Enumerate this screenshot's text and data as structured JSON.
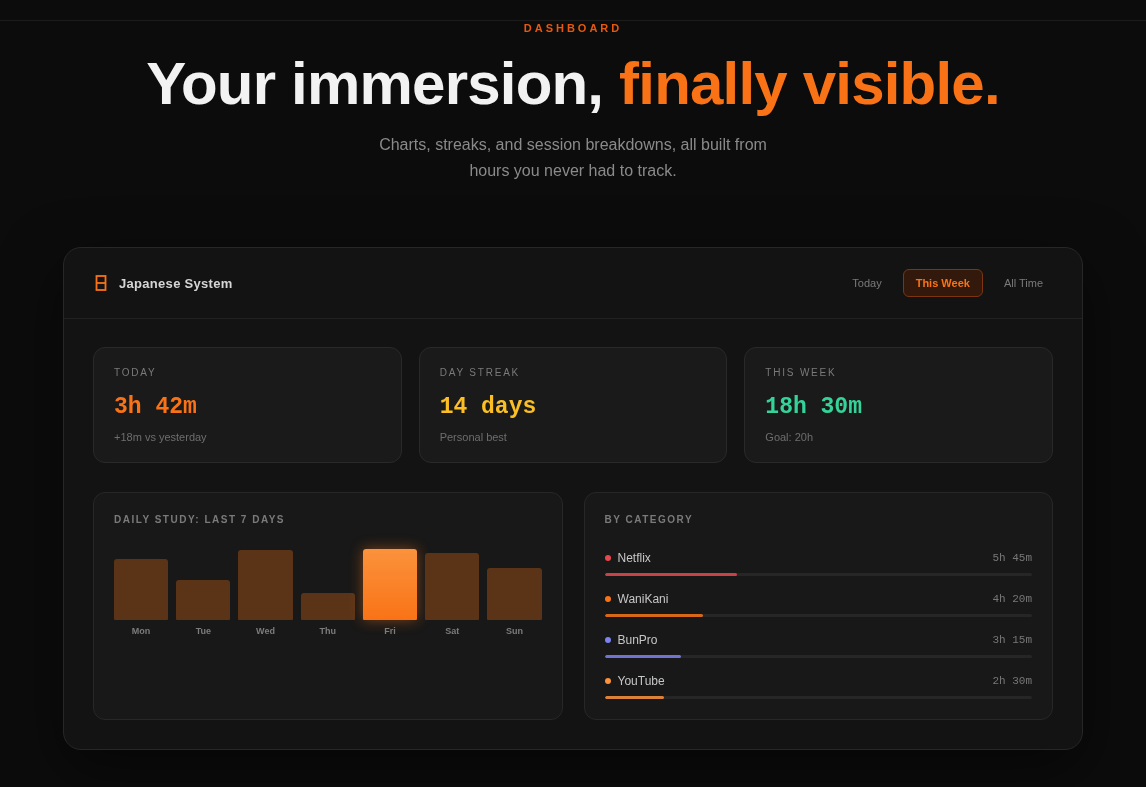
{
  "hero": {
    "eyebrow": "DASHBOARD",
    "heading": [
      {
        "text": "Your immersion,",
        "accent": false
      },
      {
        "text": "finally visible.",
        "accent": true
      }
    ],
    "subtitle": "Charts, streaks, and session breakdowns, all built from hours you never had to track."
  },
  "panel": {
    "title": "Japanese System",
    "tabs": [
      {
        "label": "Today",
        "selected": false
      },
      {
        "label": "This Week",
        "selected": true
      },
      {
        "label": "All Time",
        "selected": false
      }
    ]
  },
  "stats": [
    {
      "label": "TODAY",
      "value": "3h 42m",
      "note": "+18m vs yesterday",
      "color": "#f97316"
    },
    {
      "label": "DAY STREAK",
      "value": "14 days",
      "note": "Personal best",
      "color": "#fbbf24"
    },
    {
      "label": "THIS WEEK",
      "value": "18h 30m",
      "note": "Goal: 20h",
      "color": "#34d399"
    }
  ],
  "daily_study": {
    "title": "DAILY STUDY: LAST 7 DAYS",
    "days": [
      {
        "label": "Mon",
        "selected": false
      },
      {
        "label": "Tue",
        "selected": false
      },
      {
        "label": "Wed",
        "selected": false
      },
      {
        "label": "Thu",
        "selected": false
      },
      {
        "label": "Fri",
        "selected": true
      },
      {
        "label": "Sat",
        "selected": false
      },
      {
        "label": "Sun",
        "selected": false
      }
    ]
  },
  "by_category": {
    "title": "BY CATEGORY",
    "items": [
      {
        "name": "Netflix",
        "time": "5h 45m",
        "color": "#e5484d",
        "level": 0.31
      },
      {
        "name": "WaniKani",
        "time": "4h 20m",
        "color": "#f97316",
        "level": 0.23
      },
      {
        "name": "BunPro",
        "time": "3h 15m",
        "color": "#7c82f0",
        "level": 0.18
      },
      {
        "name": "YouTube",
        "time": "2h 30m",
        "color": "#fb923c",
        "level": 0.14
      }
    ]
  }
}
